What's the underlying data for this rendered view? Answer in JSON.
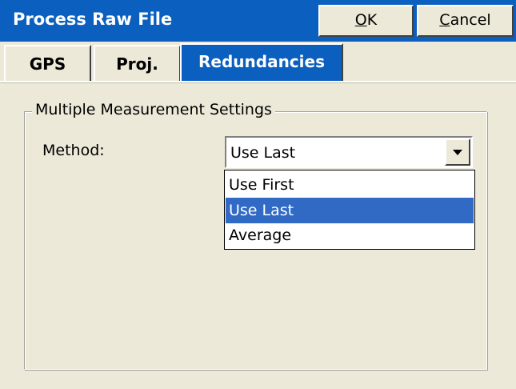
{
  "window": {
    "title": "Process Raw File",
    "ok_label": "OK",
    "ok_mnemonic": "O",
    "ok_rest": "K",
    "cancel_label": "Cancel",
    "cancel_mnemonic": "C",
    "cancel_rest": "ancel"
  },
  "tabs": [
    {
      "label": "GPS",
      "selected": false
    },
    {
      "label": "Proj.",
      "selected": false
    },
    {
      "label": "Redundancies",
      "selected": true
    }
  ],
  "group": {
    "title": "Multiple Measurement Settings",
    "method_label": "Method:",
    "method_value": "Use Last",
    "options": [
      "Use First",
      "Use Last",
      "Average"
    ],
    "highlighted_option": "Use Last"
  },
  "icons": {
    "combo_arrow": "chevron-down-icon"
  },
  "colors": {
    "title_bar": "#0a5fbf",
    "selected_tab": "#0a5fbf",
    "highlight": "#316ac5",
    "background": "#ece9d8"
  }
}
